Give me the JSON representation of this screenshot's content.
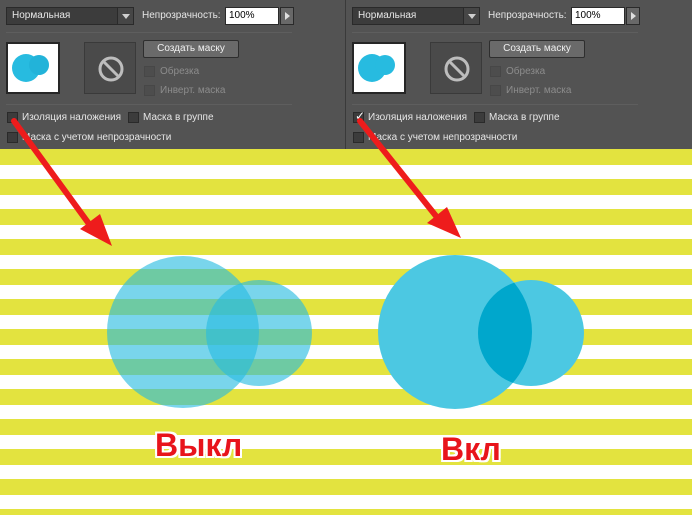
{
  "panels": [
    {
      "blend_mode": "Нормальная",
      "opacity_label": "Непрозрачность:",
      "opacity_value": "100%",
      "create_mask_label": "Создать маску",
      "clip_label": "Обрезка",
      "invert_mask_label": "Инверт. маска",
      "knockout_label": "Изоляция наложения",
      "knockout_checked": false,
      "group_mask_label": "Маска в группе",
      "opacity_mask_label": "Маска с учетом непрозрачности"
    },
    {
      "blend_mode": "Нормальная",
      "opacity_label": "Непрозрачность:",
      "opacity_value": "100%",
      "create_mask_label": "Создать маску",
      "clip_label": "Обрезка",
      "invert_mask_label": "Инверт. маска",
      "knockout_label": "Изоляция наложения",
      "knockout_checked": true,
      "group_mask_label": "Маска в группе",
      "opacity_mask_label": "Маска с учетом непрозрачности"
    }
  ],
  "labels": {
    "off": "Выкл",
    "on": "Вкл"
  },
  "colors": {
    "panel_bg": "#535353",
    "stripe_yellow": "#e3e33f",
    "circle_cyan": "#27bbe0",
    "circle_green": "#29a85a",
    "arrow_red": "#ee1c1c"
  }
}
